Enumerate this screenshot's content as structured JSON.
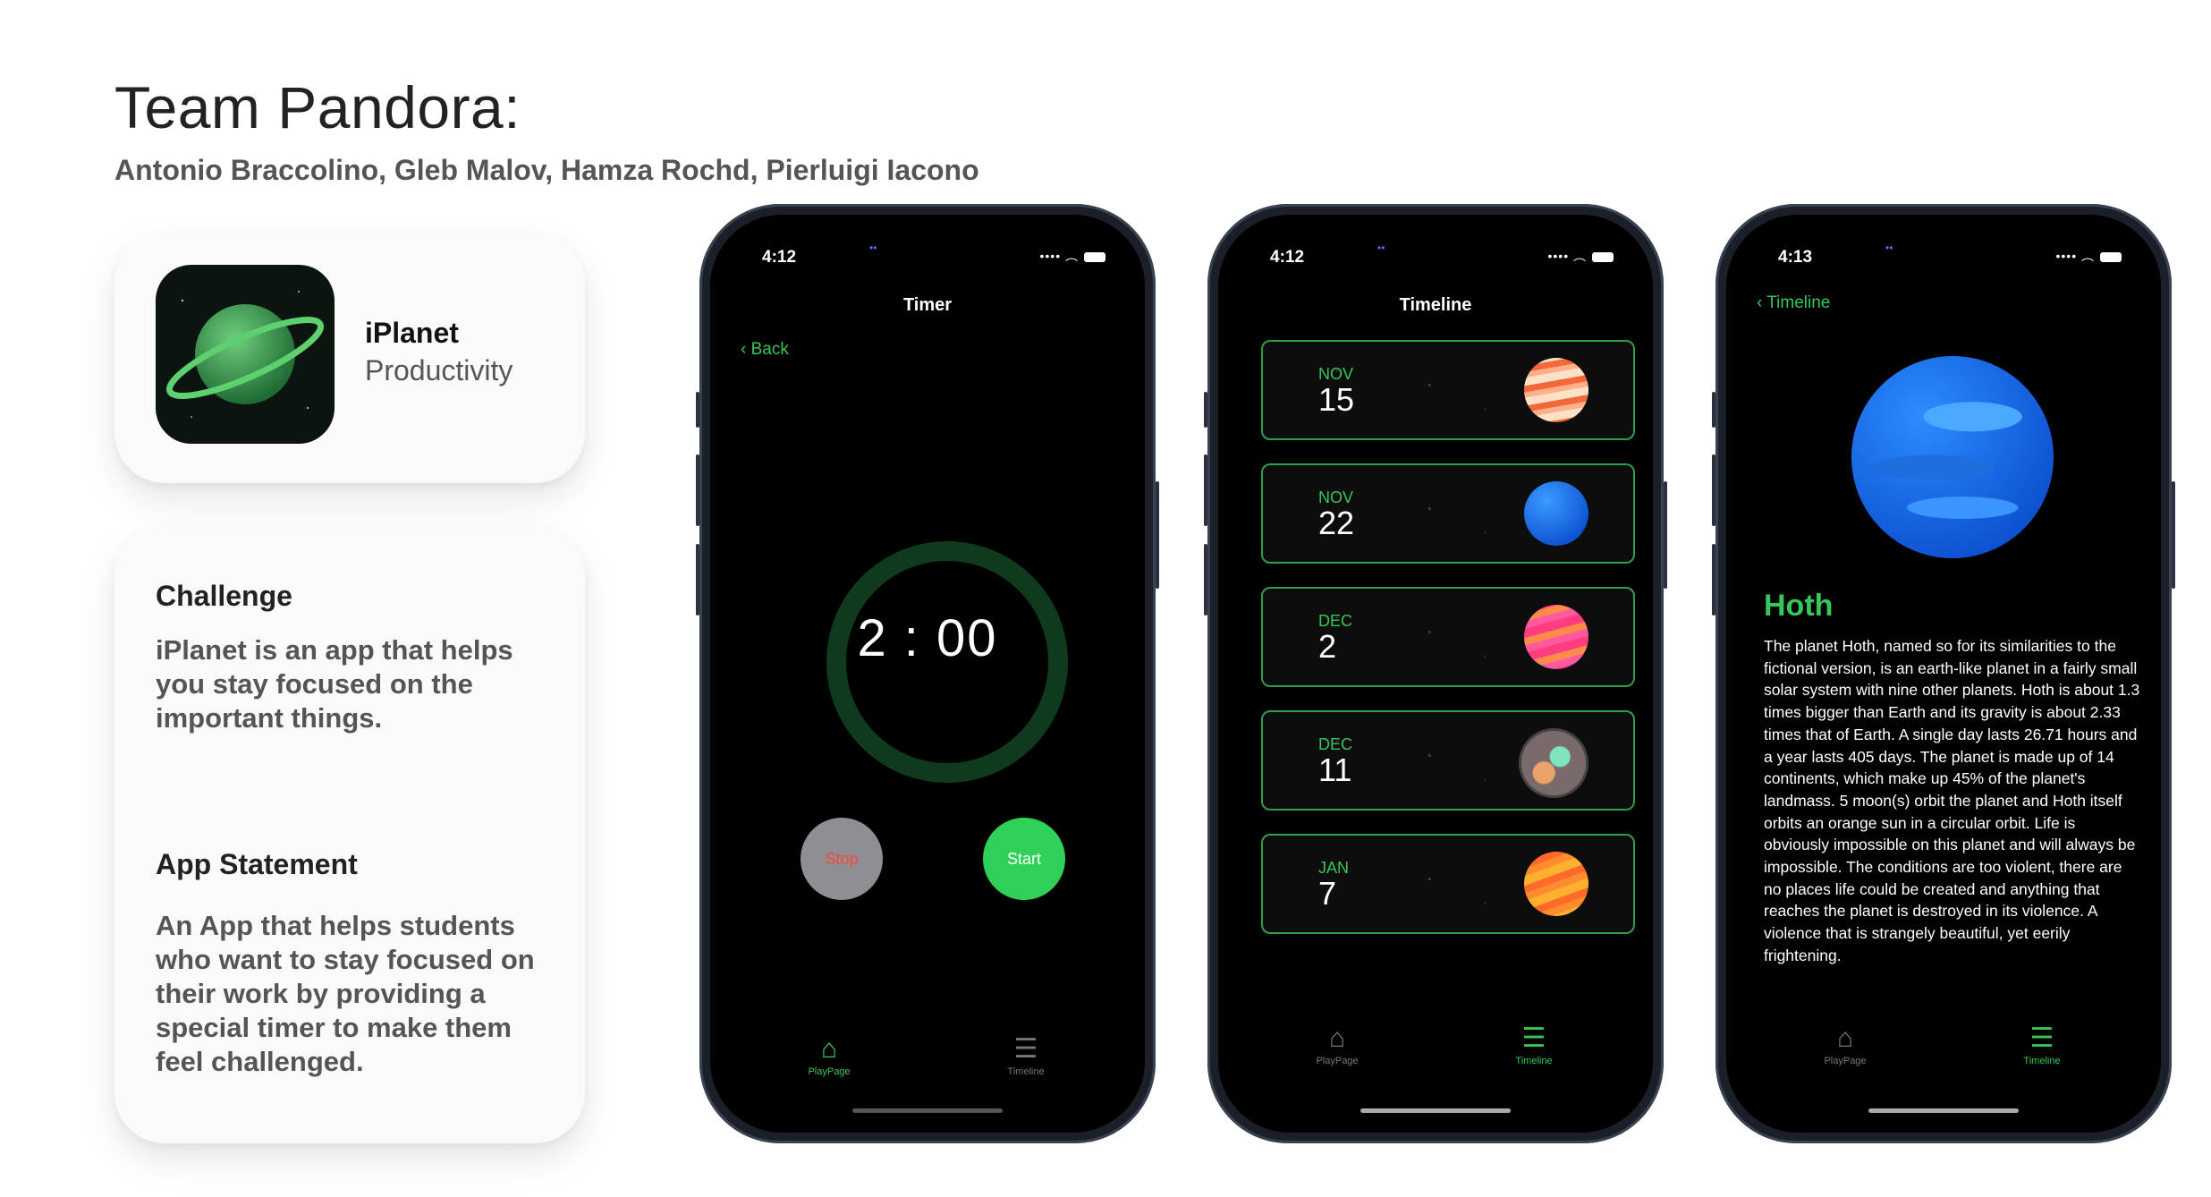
{
  "header": {
    "team_title": "Team Pandora:",
    "members": "Antonio Braccolino, Gleb Malov, Hamza Rochd, Pierluigi Iacono"
  },
  "app_card": {
    "name": "iPlanet",
    "category": "Productivity",
    "icon": "green-ringed-planet-icon"
  },
  "info_card": {
    "challenge_title": "Challenge",
    "challenge_text": "iPlanet is an app that helps you stay focused on the important things.",
    "statement_title": "App Statement",
    "statement_text": "An App that helps students who want to stay focused on their work by providing a special timer to make them feel challenged."
  },
  "colors": {
    "accent": "#34c759",
    "stop_text": "#ff453a",
    "stop_bg": "#8e8e93"
  },
  "phone1": {
    "time": "4:12",
    "title": "Timer",
    "back": "Back",
    "timer": "2 : 00",
    "stop": "Stop",
    "start": "Start",
    "tabs": [
      {
        "label": "PlayPage",
        "icon": "house-icon",
        "active": true
      },
      {
        "label": "Timeline",
        "icon": "timeline-icon",
        "active": false
      }
    ]
  },
  "phone2": {
    "time": "4:12",
    "title": "Timeline",
    "entries": [
      {
        "month": "NOV",
        "day": "15",
        "planet": "orange-banded-planet"
      },
      {
        "month": "NOV",
        "day": "22",
        "planet": "blue-planet"
      },
      {
        "month": "DEC",
        "day": "2",
        "planet": "pink-planet"
      },
      {
        "month": "DEC",
        "day": "11",
        "planet": "continents-planet"
      },
      {
        "month": "JAN",
        "day": "7",
        "planet": "orange-planet"
      }
    ],
    "tabs": [
      {
        "label": "PlayPage",
        "icon": "house-icon",
        "active": false
      },
      {
        "label": "Timeline",
        "icon": "timeline-icon",
        "active": true
      }
    ]
  },
  "phone3": {
    "time": "4:13",
    "back": "Timeline",
    "planet_name": "Hoth",
    "description": "The planet Hoth, named so for its similarities to the fictional version, is an earth-like planet in a fairly small solar system with nine other planets. Hoth is about 1.3 times bigger than Earth and its gravity is about 2.33 times that of Earth. A single day lasts 26.71 hours and a year lasts 405 days. The planet is made up of 14 continents, which make up 45% of the planet's landmass. 5 moon(s) orbit the planet and Hoth itself orbits an orange sun in a circular orbit. Life is obviously impossible on this planet and will always be impossible. The conditions are too violent, there are no places life could be created and anything that reaches the planet is destroyed in its violence. A violence that is strangely beautiful, yet eerily frightening.",
    "tabs": [
      {
        "label": "PlayPage",
        "icon": "house-icon",
        "active": false
      },
      {
        "label": "Timeline",
        "icon": "timeline-icon",
        "active": true
      }
    ]
  }
}
